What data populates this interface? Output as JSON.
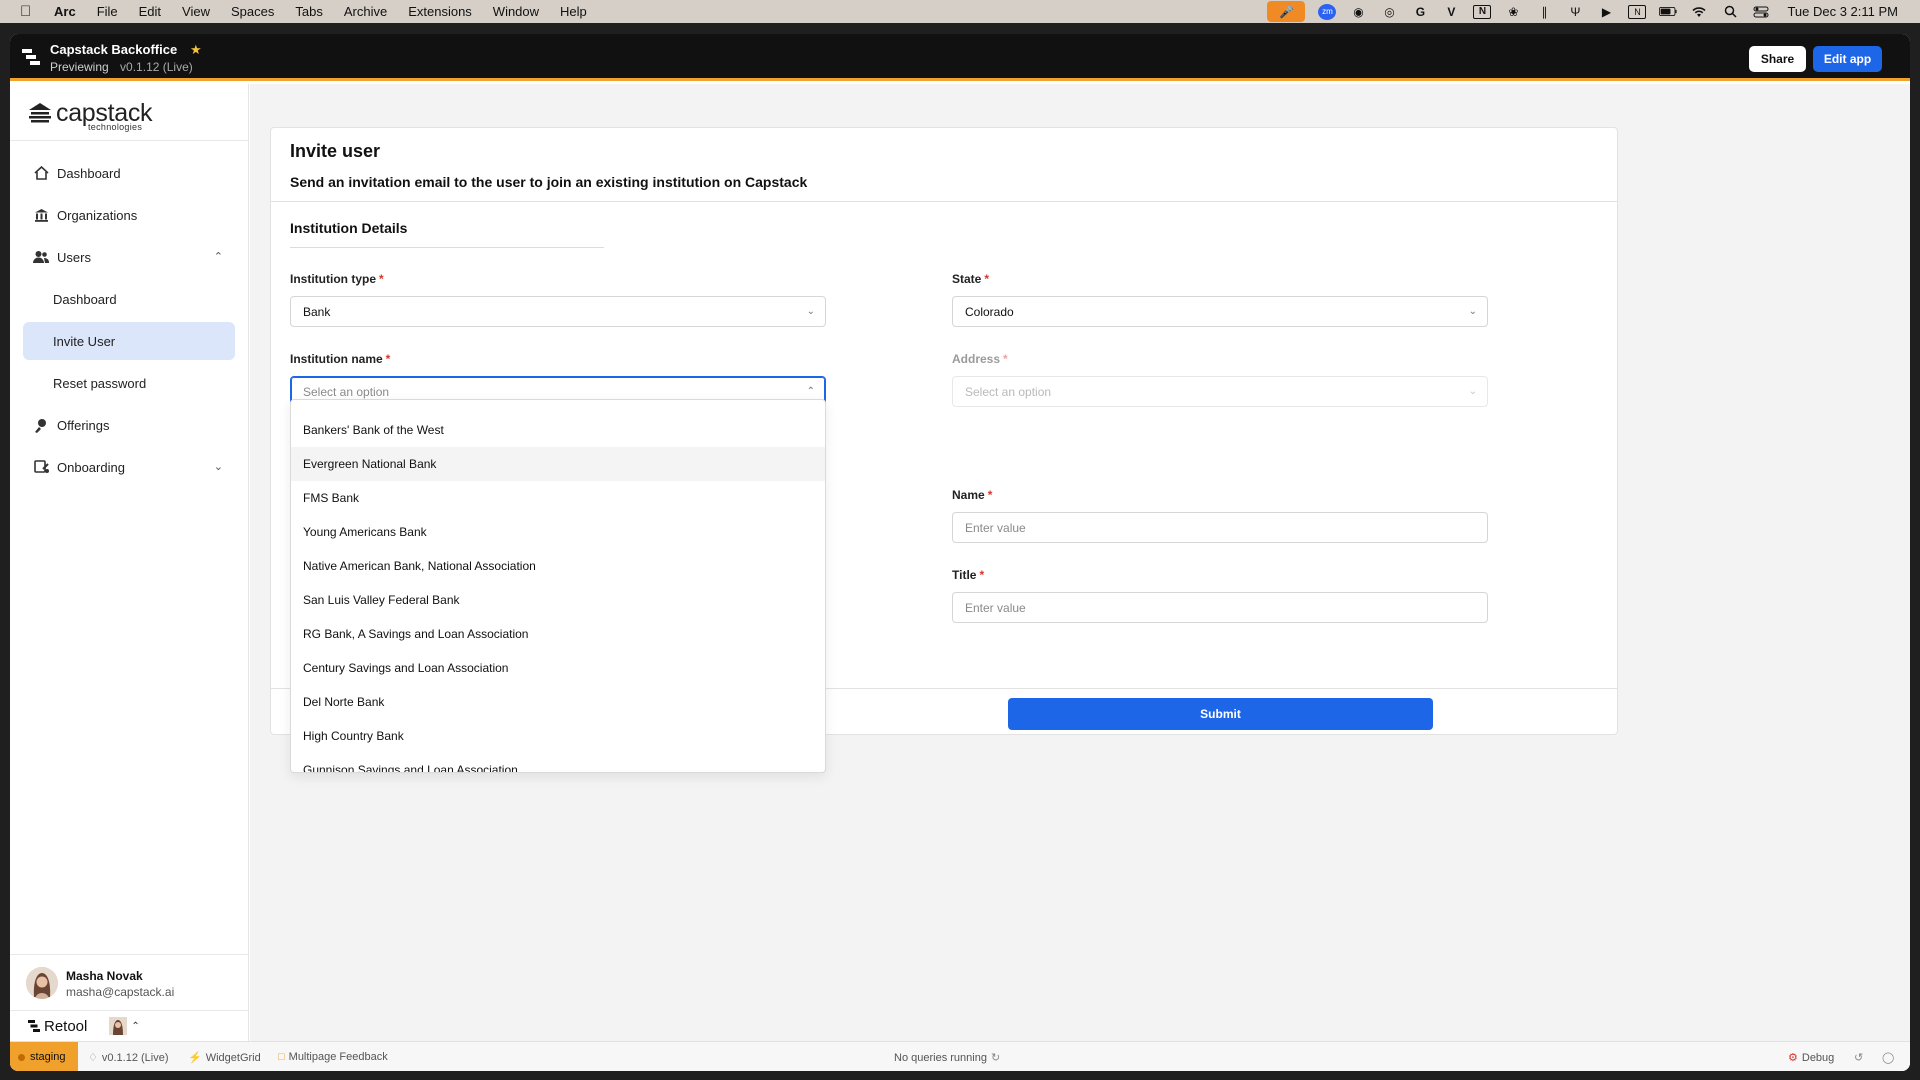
{
  "menubar": {
    "apple_icon": "apple-icon",
    "items": [
      "Arc",
      "File",
      "Edit",
      "View",
      "Spaces",
      "Tabs",
      "Archive",
      "Extensions",
      "Window",
      "Help"
    ],
    "status_icons": [
      "microphone-icon",
      "zoom-icon",
      "grammarly-icon",
      "copilot-icon",
      "g-icon",
      "v-icon",
      "notion-icon",
      "openai-icon",
      "bars-icon",
      "antenna-icon",
      "play-icon",
      "n-box-icon",
      "battery-icon",
      "wifi-icon",
      "search-icon",
      "control-center-icon"
    ],
    "zoom_label": "zm",
    "clock": "Tue Dec 3  2:11 PM"
  },
  "topbar": {
    "app_title": "Capstack Backoffice",
    "mode": "Previewing",
    "version": "v0.1.12 (Live)",
    "share_label": "Share",
    "edit_label": "Edit app"
  },
  "sidebar": {
    "brand_word": "capstack",
    "brand_sub": "technologies",
    "items": [
      {
        "label": "Dashboard",
        "icon": "home-icon"
      },
      {
        "label": "Organizations",
        "icon": "bank-icon"
      },
      {
        "label": "Users",
        "icon": "users-icon"
      },
      {
        "label": "Dashboard"
      },
      {
        "label": "Invite User"
      },
      {
        "label": "Reset password"
      },
      {
        "label": "Offerings",
        "icon": "offerings-icon"
      },
      {
        "label": "Onboarding",
        "icon": "onboarding-icon"
      }
    ],
    "user": {
      "name": "Masha Novak",
      "email": "masha@capstack.ai"
    },
    "retool_label": "Retool"
  },
  "form": {
    "title": "Invite user",
    "subtitle": "Send an invitation email to the user to join an existing institution on Capstack",
    "section": "Institution Details",
    "institution_type": {
      "label": "Institution type",
      "value": "Bank"
    },
    "state": {
      "label": "State",
      "value": "Colorado"
    },
    "institution_name": {
      "label": "Institution name",
      "placeholder": "Select an option"
    },
    "address": {
      "label": "Address",
      "placeholder": "Select an option"
    },
    "name": {
      "label": "Name",
      "placeholder": "Enter value"
    },
    "title_field": {
      "label": "Title",
      "placeholder": "Enter value"
    },
    "required_mark": "*",
    "submit_label": "Submit"
  },
  "dropdown": {
    "options": [
      "Bankers' Bank of the West",
      "Evergreen National Bank",
      "FMS Bank",
      "Young Americans Bank",
      "Native American Bank, National Association",
      "San Luis Valley Federal Bank",
      "RG Bank, A Savings and Loan Association",
      "Century Savings and Loan Association",
      "Del Norte Bank",
      "High Country Bank",
      "Gunnison Savings and Loan Association"
    ],
    "hovered_index": 1
  },
  "statusbar": {
    "env": "staging",
    "version": "v0.1.12 (Live)",
    "widget": "WidgetGrid",
    "feedback": "Multipage Feedback",
    "queries": "No queries running",
    "debug": "Debug"
  }
}
